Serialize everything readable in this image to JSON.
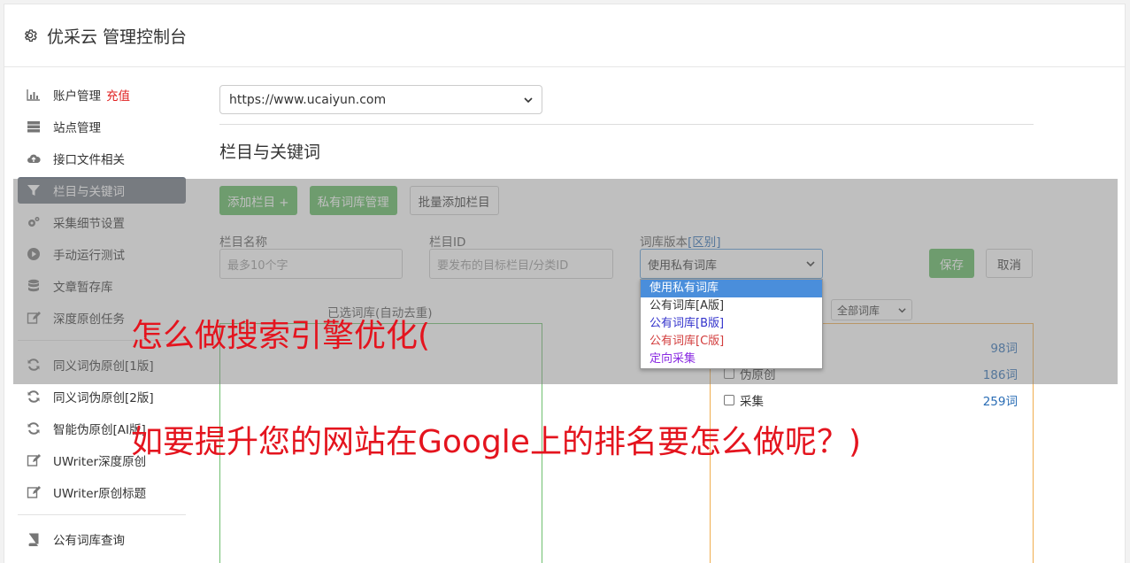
{
  "header": {
    "title": "优采云 管理控制台",
    "icon": "gear-icon"
  },
  "sidebar": {
    "groups": [
      [
        {
          "label": "账户管理",
          "badge": "充值",
          "icon": "bar-chart-icon"
        },
        {
          "label": "站点管理",
          "icon": "server-icon"
        },
        {
          "label": "接口文件相关",
          "icon": "cloud-upload-icon"
        },
        {
          "label": "栏目与关键词",
          "icon": "filter-icon",
          "active": true
        },
        {
          "label": "采集细节设置",
          "icon": "cogs-icon"
        },
        {
          "label": "手动运行测试",
          "icon": "play-icon"
        },
        {
          "label": "文章暂存库",
          "icon": "database-icon"
        },
        {
          "label": "深度原创任务",
          "icon": "edit-icon"
        }
      ],
      [
        {
          "label": "同义词伪原创[1版]",
          "icon": "refresh-icon"
        },
        {
          "label": "同义词伪原创[2版]",
          "icon": "refresh-icon"
        },
        {
          "label": "智能伪原创[AI版]",
          "icon": "refresh-icon"
        },
        {
          "label": "UWriter深度原创",
          "icon": "edit-icon"
        },
        {
          "label": "UWriter原创标题",
          "icon": "edit-icon"
        }
      ],
      [
        {
          "label": "公有词库查询",
          "icon": "book-icon"
        }
      ]
    ]
  },
  "main": {
    "site_select": "https://www.ucaiyun.com",
    "section_title": "栏目与关键词",
    "buttons": {
      "add": "添加栏目 +",
      "private_lib": "私有词库管理",
      "batch_add": "批量添加栏目"
    },
    "fields": {
      "name_label": "栏目名称",
      "name_placeholder": "最多10个字",
      "id_label": "栏目ID",
      "id_placeholder": "要发布的目标栏目/分类ID",
      "version_label": "词库版本",
      "version_link": "[区别]",
      "version_value": "使用私有词库"
    },
    "save": "保存",
    "cancel": "取消",
    "version_options": [
      {
        "label": "使用私有词库",
        "color": "#ffffff",
        "selected": true
      },
      {
        "label": "公有词库[A版]",
        "color": "#333333"
      },
      {
        "label": "公有词库[B版]",
        "color": "#3333cc"
      },
      {
        "label": "公有词库[C版]",
        "color": "#d23c3c"
      },
      {
        "label": "定向采集",
        "color": "#8a2be2"
      }
    ],
    "selected_words_label": "已选词库(自动去重)",
    "lib_filter": "全部词库",
    "library_rows": [
      {
        "label": "",
        "count": "98词"
      },
      {
        "label": "伪原创",
        "count": "186词"
      },
      {
        "label": "采集",
        "count": "259词"
      }
    ]
  },
  "watermark": {
    "line1": "怎么做搜索引擎优化(",
    "line2": "如要提升您的网站在Google上的排名要怎么做呢？)"
  }
}
